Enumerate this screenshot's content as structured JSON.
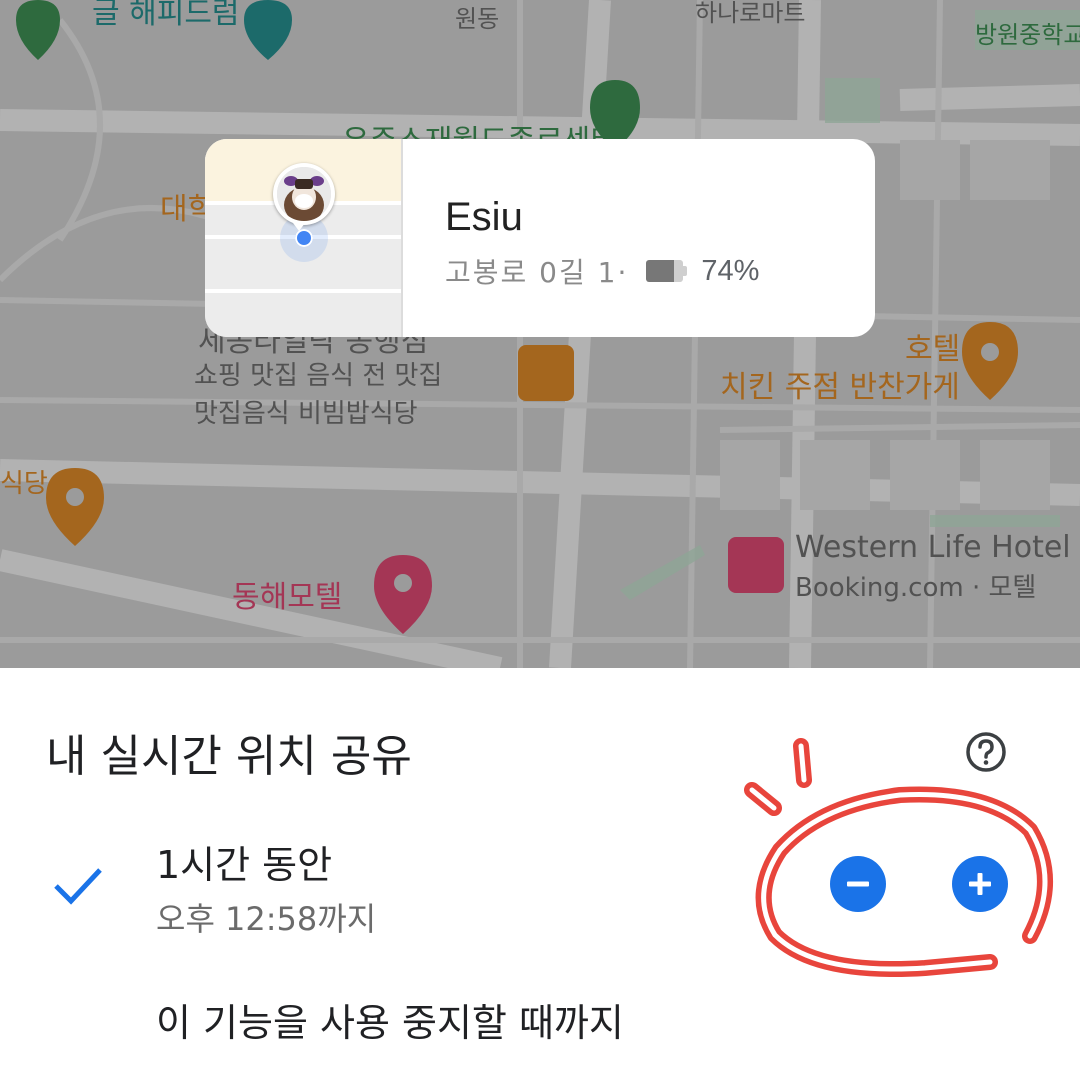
{
  "map": {
    "labels": [
      {
        "text": "글 해피드럼",
        "kind": "teal"
      },
      {
        "text": "원동",
        "kind": "dark"
      },
      {
        "text": "하나로마트",
        "kind": "dark"
      },
      {
        "text": "방원중학교",
        "kind": "green"
      },
      {
        "text": "우주소재월드종로센터",
        "kind": "green"
      },
      {
        "text": "대학",
        "kind": "orange"
      },
      {
        "text": "세종라일락 동행점",
        "kind": "dark"
      },
      {
        "text": "쇼핑 맛집 음식 전 맛집",
        "kind": "dark"
      },
      {
        "text": "맛집음식 비빔밥식당",
        "kind": "dark"
      },
      {
        "text": "호텔",
        "kind": "orange"
      },
      {
        "text": "치킨 주점 반찬가게",
        "kind": "orange"
      },
      {
        "text": "동해모텔",
        "kind": "pink"
      },
      {
        "text": "Western Life Hotel",
        "kind": "dark"
      },
      {
        "text": "Booking.com · 모텔",
        "kind": "dark"
      },
      {
        "text": "식당",
        "kind": "orange"
      }
    ]
  },
  "card": {
    "name": "Esiu",
    "address": "고봉로 0길 1·",
    "battery_percent": "74%",
    "battery_level": 0.74
  },
  "sheet": {
    "title": "내 실시간 위치 공유",
    "option1_label": "1시간 동안",
    "option1_sub": "오후 12:58까지",
    "option2_label": "이 기능을 사용 중지할 때까지",
    "help_icon": "help-circle-icon",
    "check_icon": "check-icon",
    "minus_icon": "minus-icon",
    "plus_icon": "plus-icon"
  },
  "colors": {
    "accent": "#1a73e8",
    "annotation": "#e8453c"
  }
}
